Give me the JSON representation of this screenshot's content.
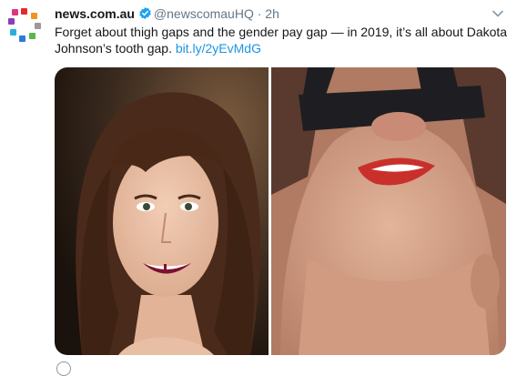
{
  "tweet": {
    "display_name": "news.com.au",
    "handle": "@newscomauHQ",
    "separator": "·",
    "time": "2h",
    "text": "Forget about thigh gaps and the gender pay gap — in 2019, it’s all about Dakota Johnson’s tooth gap.",
    "link": "bit.ly/2yEvMdG"
  },
  "icons": {
    "avatar": "news-logo-icon",
    "verified": "verified-badge-icon",
    "menu": "chevron-down-icon",
    "reply": "reply-icon"
  },
  "colors": {
    "link": "#1b95e0",
    "verified": "#1da1f2",
    "muted": "#657786",
    "logo_red": "#e42a2f",
    "logo_blue": "#2f7bd6",
    "logo_green": "#5bb848",
    "logo_purple": "#8a3fb5",
    "logo_grey": "#9a9a9a"
  }
}
